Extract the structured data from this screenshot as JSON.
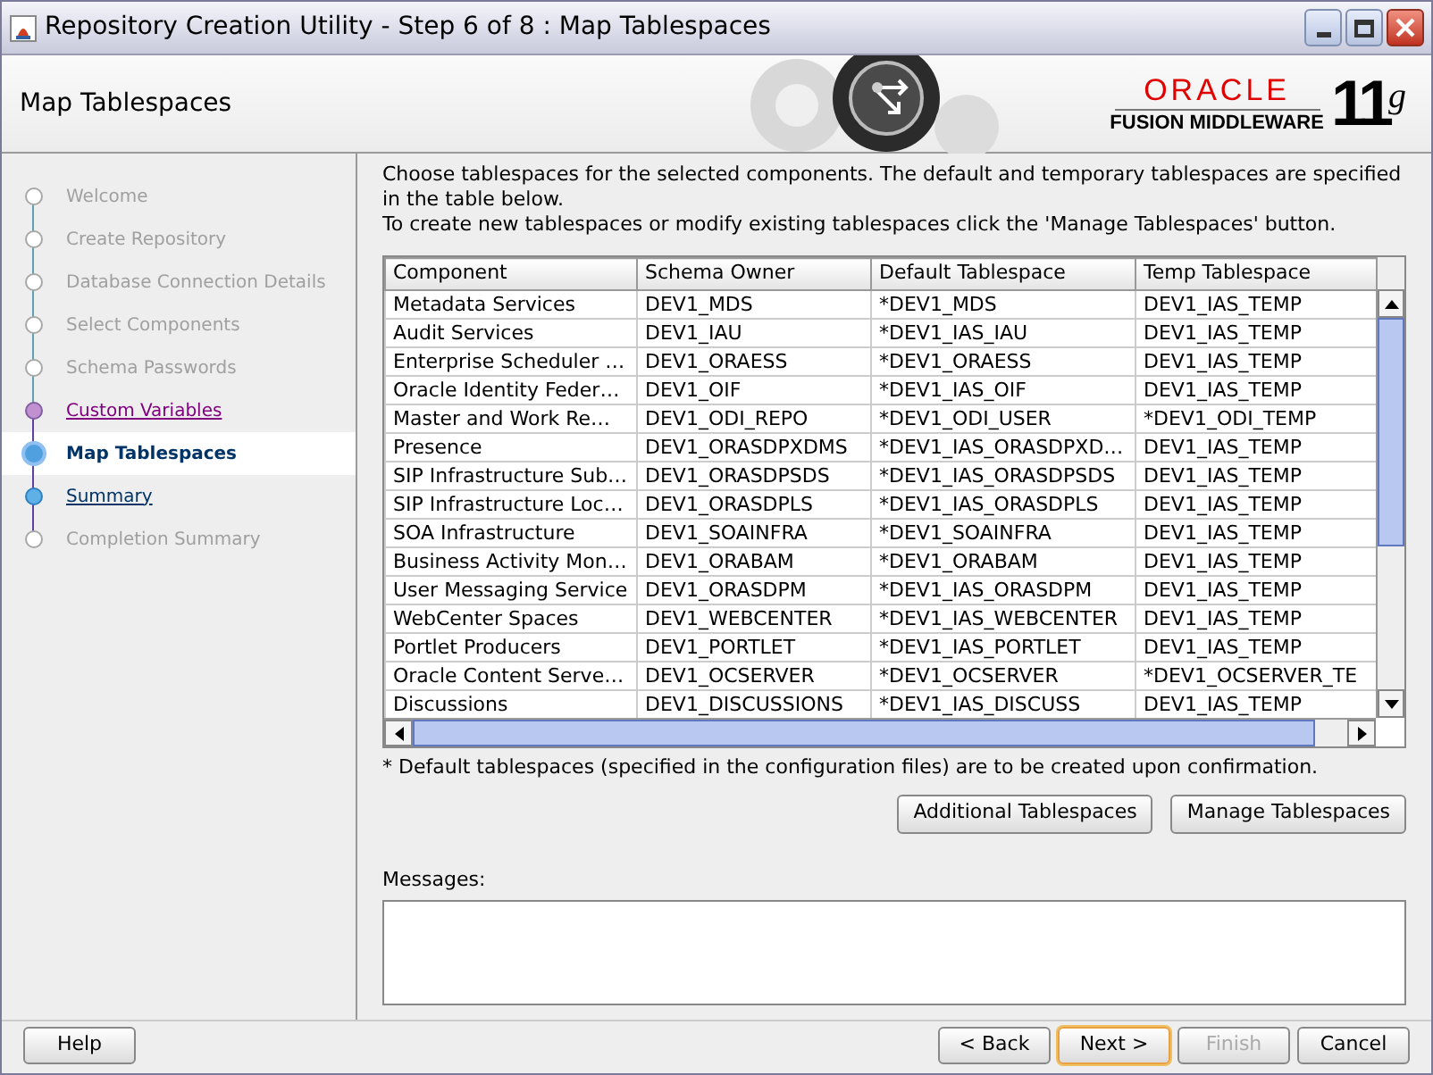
{
  "window": {
    "title": "Repository Creation Utility - Step 6 of 8 : Map Tablespaces"
  },
  "header": {
    "title": "Map Tablespaces",
    "brand": "ORACLE",
    "product": "FUSION MIDDLEWARE",
    "version": "11",
    "version_suffix": "g"
  },
  "steps": [
    {
      "label": "Welcome",
      "kind": "done",
      "selected": false
    },
    {
      "label": "Create Repository",
      "kind": "done",
      "selected": false
    },
    {
      "label": "Database Connection Details",
      "kind": "done",
      "selected": false
    },
    {
      "label": "Select Components",
      "kind": "done",
      "selected": false
    },
    {
      "label": "Schema Passwords",
      "kind": "done",
      "selected": false
    },
    {
      "label": "Custom Variables",
      "kind": "visited",
      "selected": false
    },
    {
      "label": "Map Tablespaces",
      "kind": "current",
      "selected": true
    },
    {
      "label": "Summary",
      "kind": "link",
      "selected": false
    },
    {
      "label": "Completion Summary",
      "kind": "pending",
      "selected": false
    }
  ],
  "intro": [
    "Choose tablespaces for the selected components. The default and temporary tablespaces are specified in the table below.",
    "To create new tablespaces or modify existing tablespaces click the 'Manage Tablespaces' button."
  ],
  "table": {
    "columns": [
      "Component",
      "Schema Owner",
      "Default Tablespace",
      "Temp Tablespace"
    ],
    "rows": [
      [
        "Metadata Services",
        "DEV1_MDS",
        "*DEV1_MDS",
        "DEV1_IAS_TEMP"
      ],
      [
        "Audit Services",
        "DEV1_IAU",
        "*DEV1_IAS_IAU",
        "DEV1_IAS_TEMP"
      ],
      [
        "Enterprise Scheduler …",
        "DEV1_ORAESS",
        "*DEV1_ORAESS",
        "DEV1_IAS_TEMP"
      ],
      [
        "Oracle Identity Feder…",
        "DEV1_OIF",
        "*DEV1_IAS_OIF",
        "DEV1_IAS_TEMP"
      ],
      [
        "Master and Work Re…",
        "DEV1_ODI_REPO",
        "*DEV1_ODI_USER",
        "*DEV1_ODI_TEMP"
      ],
      [
        "Presence",
        "DEV1_ORASDPXDMS",
        "*DEV1_IAS_ORASDPXD…",
        "DEV1_IAS_TEMP"
      ],
      [
        "SIP Infrastructure Sub…",
        "DEV1_ORASDPSDS",
        "*DEV1_IAS_ORASDPSDS",
        "DEV1_IAS_TEMP"
      ],
      [
        "SIP Infrastructure Loc…",
        "DEV1_ORASDPLS",
        "*DEV1_IAS_ORASDPLS",
        "DEV1_IAS_TEMP"
      ],
      [
        "SOA Infrastructure",
        "DEV1_SOAINFRA",
        "*DEV1_SOAINFRA",
        "DEV1_IAS_TEMP"
      ],
      [
        "Business Activity Mon…",
        "DEV1_ORABAM",
        "*DEV1_ORABAM",
        "DEV1_IAS_TEMP"
      ],
      [
        "User Messaging Service",
        "DEV1_ORASDPM",
        "*DEV1_IAS_ORASDPM",
        "DEV1_IAS_TEMP"
      ],
      [
        "WebCenter Spaces",
        "DEV1_WEBCENTER",
        "*DEV1_IAS_WEBCENTER",
        "DEV1_IAS_TEMP"
      ],
      [
        "Portlet Producers",
        "DEV1_PORTLET",
        "*DEV1_IAS_PORTLET",
        "DEV1_IAS_TEMP"
      ],
      [
        "Oracle Content Serve…",
        "DEV1_OCSERVER",
        "*DEV1_OCSERVER",
        "*DEV1_OCSERVER_TE"
      ],
      [
        "Discussions",
        "DEV1_DISCUSSIONS",
        "*DEV1_IAS_DISCUSS",
        "DEV1_IAS_TEMP"
      ]
    ]
  },
  "footnote": "* Default tablespaces (specified in the configuration files) are to be created upon confirmation.",
  "table_buttons": [
    "Additional Tablespaces",
    "Manage Tablespaces"
  ],
  "messages": {
    "label": "Messages:"
  },
  "footer": {
    "help": "Help",
    "buttons": [
      {
        "label": "< Back",
        "disabled": false,
        "default": false
      },
      {
        "label": "Next >",
        "disabled": false,
        "default": true
      },
      {
        "label": "Finish",
        "disabled": true,
        "default": false
      },
      {
        "label": "Cancel",
        "disabled": false,
        "default": false
      }
    ]
  }
}
